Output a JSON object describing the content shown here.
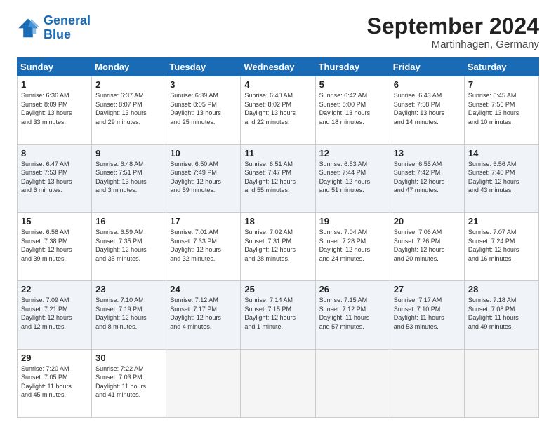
{
  "header": {
    "logo_line1": "General",
    "logo_line2": "Blue",
    "month": "September 2024",
    "location": "Martinhagen, Germany"
  },
  "weekdays": [
    "Sunday",
    "Monday",
    "Tuesday",
    "Wednesday",
    "Thursday",
    "Friday",
    "Saturday"
  ],
  "weeks": [
    [
      {
        "day": "1",
        "info": "Sunrise: 6:36 AM\nSunset: 8:09 PM\nDaylight: 13 hours\nand 33 minutes."
      },
      {
        "day": "2",
        "info": "Sunrise: 6:37 AM\nSunset: 8:07 PM\nDaylight: 13 hours\nand 29 minutes."
      },
      {
        "day": "3",
        "info": "Sunrise: 6:39 AM\nSunset: 8:05 PM\nDaylight: 13 hours\nand 25 minutes."
      },
      {
        "day": "4",
        "info": "Sunrise: 6:40 AM\nSunset: 8:02 PM\nDaylight: 13 hours\nand 22 minutes."
      },
      {
        "day": "5",
        "info": "Sunrise: 6:42 AM\nSunset: 8:00 PM\nDaylight: 13 hours\nand 18 minutes."
      },
      {
        "day": "6",
        "info": "Sunrise: 6:43 AM\nSunset: 7:58 PM\nDaylight: 13 hours\nand 14 minutes."
      },
      {
        "day": "7",
        "info": "Sunrise: 6:45 AM\nSunset: 7:56 PM\nDaylight: 13 hours\nand 10 minutes."
      }
    ],
    [
      {
        "day": "8",
        "info": "Sunrise: 6:47 AM\nSunset: 7:53 PM\nDaylight: 13 hours\nand 6 minutes."
      },
      {
        "day": "9",
        "info": "Sunrise: 6:48 AM\nSunset: 7:51 PM\nDaylight: 13 hours\nand 3 minutes."
      },
      {
        "day": "10",
        "info": "Sunrise: 6:50 AM\nSunset: 7:49 PM\nDaylight: 12 hours\nand 59 minutes."
      },
      {
        "day": "11",
        "info": "Sunrise: 6:51 AM\nSunset: 7:47 PM\nDaylight: 12 hours\nand 55 minutes."
      },
      {
        "day": "12",
        "info": "Sunrise: 6:53 AM\nSunset: 7:44 PM\nDaylight: 12 hours\nand 51 minutes."
      },
      {
        "day": "13",
        "info": "Sunrise: 6:55 AM\nSunset: 7:42 PM\nDaylight: 12 hours\nand 47 minutes."
      },
      {
        "day": "14",
        "info": "Sunrise: 6:56 AM\nSunset: 7:40 PM\nDaylight: 12 hours\nand 43 minutes."
      }
    ],
    [
      {
        "day": "15",
        "info": "Sunrise: 6:58 AM\nSunset: 7:38 PM\nDaylight: 12 hours\nand 39 minutes."
      },
      {
        "day": "16",
        "info": "Sunrise: 6:59 AM\nSunset: 7:35 PM\nDaylight: 12 hours\nand 35 minutes."
      },
      {
        "day": "17",
        "info": "Sunrise: 7:01 AM\nSunset: 7:33 PM\nDaylight: 12 hours\nand 32 minutes."
      },
      {
        "day": "18",
        "info": "Sunrise: 7:02 AM\nSunset: 7:31 PM\nDaylight: 12 hours\nand 28 minutes."
      },
      {
        "day": "19",
        "info": "Sunrise: 7:04 AM\nSunset: 7:28 PM\nDaylight: 12 hours\nand 24 minutes."
      },
      {
        "day": "20",
        "info": "Sunrise: 7:06 AM\nSunset: 7:26 PM\nDaylight: 12 hours\nand 20 minutes."
      },
      {
        "day": "21",
        "info": "Sunrise: 7:07 AM\nSunset: 7:24 PM\nDaylight: 12 hours\nand 16 minutes."
      }
    ],
    [
      {
        "day": "22",
        "info": "Sunrise: 7:09 AM\nSunset: 7:21 PM\nDaylight: 12 hours\nand 12 minutes."
      },
      {
        "day": "23",
        "info": "Sunrise: 7:10 AM\nSunset: 7:19 PM\nDaylight: 12 hours\nand 8 minutes."
      },
      {
        "day": "24",
        "info": "Sunrise: 7:12 AM\nSunset: 7:17 PM\nDaylight: 12 hours\nand 4 minutes."
      },
      {
        "day": "25",
        "info": "Sunrise: 7:14 AM\nSunset: 7:15 PM\nDaylight: 12 hours\nand 1 minute."
      },
      {
        "day": "26",
        "info": "Sunrise: 7:15 AM\nSunset: 7:12 PM\nDaylight: 11 hours\nand 57 minutes."
      },
      {
        "day": "27",
        "info": "Sunrise: 7:17 AM\nSunset: 7:10 PM\nDaylight: 11 hours\nand 53 minutes."
      },
      {
        "day": "28",
        "info": "Sunrise: 7:18 AM\nSunset: 7:08 PM\nDaylight: 11 hours\nand 49 minutes."
      }
    ],
    [
      {
        "day": "29",
        "info": "Sunrise: 7:20 AM\nSunset: 7:05 PM\nDaylight: 11 hours\nand 45 minutes."
      },
      {
        "day": "30",
        "info": "Sunrise: 7:22 AM\nSunset: 7:03 PM\nDaylight: 11 hours\nand 41 minutes."
      },
      {
        "day": "",
        "info": "",
        "empty": true
      },
      {
        "day": "",
        "info": "",
        "empty": true
      },
      {
        "day": "",
        "info": "",
        "empty": true
      },
      {
        "day": "",
        "info": "",
        "empty": true
      },
      {
        "day": "",
        "info": "",
        "empty": true
      }
    ]
  ]
}
